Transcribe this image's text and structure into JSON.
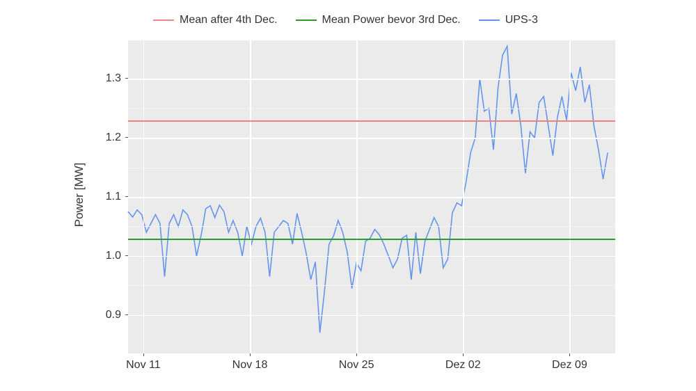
{
  "chart_data": {
    "type": "line",
    "title": "",
    "xlabel": "",
    "ylabel": "Power [MW]",
    "x_ticks": [
      "Nov 11",
      "Nov 18",
      "Nov 25",
      "Dez 02",
      "Dez 09"
    ],
    "y_ticks": [
      0.9,
      1.0,
      1.1,
      1.2,
      1.3
    ],
    "ylim": [
      0.835,
      1.365
    ],
    "xlim_days": [
      0,
      32
    ],
    "legend": [
      "Mean after 4th Dec.",
      "Mean Power bevor 3rd Dec.",
      "UPS-3"
    ],
    "mean_after_4th_dec": 1.23,
    "mean_before_3rd_dec": 1.029,
    "series": [
      {
        "name": "Mean after 4th Dec.",
        "color": "#e88581",
        "type": "hline",
        "value": 1.23
      },
      {
        "name": "Mean Power bevor 3rd Dec.",
        "color": "#2b9c2b",
        "type": "hline",
        "value": 1.029
      },
      {
        "name": "UPS-3",
        "color": "#6495ed",
        "type": "line",
        "x": [
          0,
          0.3,
          0.6,
          0.9,
          1.2,
          1.5,
          1.8,
          2.1,
          2.4,
          2.7,
          3,
          3.3,
          3.6,
          3.9,
          4.2,
          4.5,
          4.8,
          5.1,
          5.4,
          5.7,
          6,
          6.3,
          6.6,
          6.9,
          7.2,
          7.5,
          7.8,
          8.1,
          8.4,
          8.7,
          9,
          9.3,
          9.6,
          9.9,
          10.2,
          10.5,
          10.8,
          11.1,
          11.4,
          11.7,
          12,
          12.3,
          12.6,
          12.9,
          13.2,
          13.5,
          13.8,
          14.1,
          14.4,
          14.7,
          15,
          15.3,
          15.6,
          15.9,
          16.2,
          16.5,
          16.8,
          17.1,
          17.4,
          17.7,
          18,
          18.3,
          18.6,
          18.9,
          19.2,
          19.5,
          19.8,
          20.1,
          20.4,
          20.7,
          21,
          21.3,
          21.6,
          21.9,
          22.2,
          22.5,
          22.8,
          23.1,
          23.4,
          23.7,
          24,
          24.3,
          24.6,
          24.9,
          25.2,
          25.5,
          25.8,
          26.1,
          26.4,
          26.7,
          27,
          27.3,
          27.6,
          27.9,
          28.2,
          28.5,
          28.8,
          29.1,
          29.4,
          29.7,
          30,
          30.3,
          30.6,
          30.9,
          31.2,
          31.5
        ],
        "y": [
          1.075,
          1.066,
          1.078,
          1.07,
          1.04,
          1.055,
          1.07,
          1.055,
          0.965,
          1.055,
          1.07,
          1.05,
          1.078,
          1.07,
          1.05,
          1.0,
          1.035,
          1.08,
          1.085,
          1.065,
          1.086,
          1.075,
          1.04,
          1.06,
          1.04,
          1.0,
          1.05,
          1.02,
          1.05,
          1.064,
          1.04,
          0.965,
          1.04,
          1.05,
          1.06,
          1.055,
          1.02,
          1.072,
          1.04,
          1.005,
          0.96,
          0.99,
          0.87,
          0.94,
          1.02,
          1.034,
          1.06,
          1.04,
          1.006,
          0.945,
          0.988,
          0.975,
          1.025,
          1.03,
          1.045,
          1.036,
          1.02,
          1.0,
          0.98,
          0.995,
          1.03,
          1.035,
          0.96,
          1.04,
          0.97,
          1.025,
          1.045,
          1.065,
          1.05,
          0.98,
          0.995,
          1.073,
          1.09,
          1.085,
          1.125,
          1.175,
          1.2,
          1.3,
          1.245,
          1.25,
          1.18,
          1.285,
          1.34,
          1.355,
          1.24,
          1.275,
          1.22,
          1.14,
          1.21,
          1.2,
          1.26,
          1.27,
          1.22,
          1.17,
          1.235,
          1.27,
          1.23,
          1.31,
          1.28,
          1.32,
          1.26,
          1.29,
          1.22,
          1.18,
          1.13,
          1.175
        ]
      }
    ]
  }
}
